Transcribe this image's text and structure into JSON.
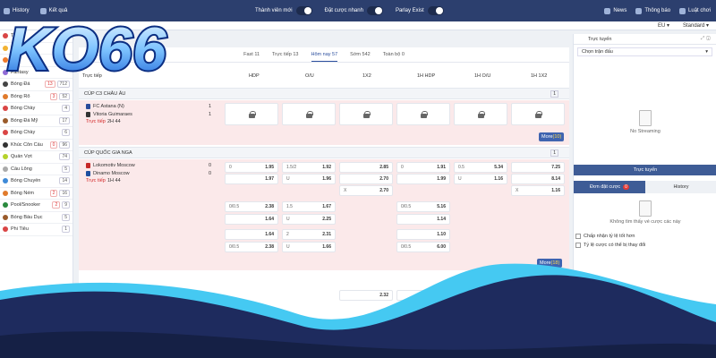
{
  "topbar": {
    "history": "History",
    "results": "Kết quả",
    "toggles": [
      "Thành viên mới",
      "Đặt cược nhanh",
      "Parlay Exist"
    ],
    "news": "News",
    "notice": "Thông báo",
    "rules": "Luật chơi"
  },
  "subbar": {
    "lang": "EU",
    "view": "Standard"
  },
  "logo": {
    "text": "KO66"
  },
  "sidebar": {
    "items": [
      {
        "label": "Trực",
        "count": "",
        "color": "#d94545"
      },
      {
        "label": "Yêu",
        "count": "",
        "color": "#f2b233"
      },
      {
        "label": "Hư",
        "count": "",
        "color": "#f07a2b"
      },
      {
        "label": "Fantasy",
        "count": "",
        "color": "#8f6bd6"
      },
      {
        "label": "Bóng Đá",
        "count": "13",
        "count2": "712",
        "color": "#444"
      },
      {
        "label": "Bóng Rổ",
        "count": "3",
        "count2": "52",
        "color": "#e07a2b"
      },
      {
        "label": "Bóng Chày",
        "count": "4",
        "count2": "",
        "color": "#d94545"
      },
      {
        "label": "Bóng Đá Mỹ",
        "count": "17",
        "count2": "",
        "color": "#9a5b2b"
      },
      {
        "label": "Bóng Chày",
        "count": "6",
        "count2": "",
        "color": "#d94545"
      },
      {
        "label": "Khúc Côn Cầu",
        "count": "0",
        "count2": "96",
        "color": "#333"
      },
      {
        "label": "Quần Vợt",
        "count": "74",
        "count2": "",
        "color": "#b5d22b"
      },
      {
        "label": "Cầu Lông",
        "count": "5",
        "count2": "",
        "color": "#aaa"
      },
      {
        "label": "Bóng Chuyền",
        "count": "14",
        "count2": "",
        "color": "#3e8ad8"
      },
      {
        "label": "Bóng Ném",
        "count": "2",
        "count2": "16",
        "color": "#e07a2b"
      },
      {
        "label": "Pool/Snooker",
        "count": "2",
        "count2": "9",
        "color": "#2b8a3e"
      },
      {
        "label": "Bóng Bầu Dục",
        "count": "5",
        "count2": "",
        "color": "#9a5b2b"
      },
      {
        "label": "Phi Tiêu",
        "count": "1",
        "count2": "",
        "color": "#d94545"
      }
    ]
  },
  "tabs": [
    "Fast 11",
    "Trực tiếp 13",
    "Hôm nay 57",
    "Sớm 542",
    "Toàn bộ 0"
  ],
  "columns": [
    "Trực tiếp",
    "HDP",
    "O/U",
    "1X2",
    "1H HDP",
    "1H O/U",
    "1H 1X2"
  ],
  "leagues": [
    {
      "name": "CÚP C3 CHÂU ÂU",
      "page": "1",
      "home": "FC Astana (N)",
      "away": "Vitoria Guimaraes",
      "hs": "1",
      "as": "1",
      "status": "Trực tiếp",
      "time": "2H 44",
      "more": "More",
      "more_n": "(10)"
    },
    {
      "name": "CÚP QUỐC GIA NGA",
      "page": "1",
      "home": "Lokomotiv Moscow",
      "away": "Dinamo Moscow",
      "hs": "0",
      "as": "0",
      "status": "Trực tiếp",
      "time": "1H 44",
      "more": "More",
      "more_n": "(18)"
    }
  ],
  "odds": {
    "r1": [
      [
        "0",
        "1.95"
      ],
      [
        "1.5/2",
        "1.92"
      ],
      [
        "",
        "2.85"
      ],
      [
        "0",
        "1.91"
      ],
      [
        "0.5",
        "5.34"
      ],
      [
        "",
        "7.25"
      ]
    ],
    "r2": [
      [
        "",
        "1.97"
      ],
      [
        "U",
        "1.96"
      ],
      [
        "",
        "2.70"
      ],
      [
        "",
        "1.99"
      ],
      [
        "U",
        "1.16"
      ],
      [
        "",
        "8.14"
      ]
    ],
    "r3": [
      [
        "X",
        "2.70"
      ],
      [
        "X",
        "1.16"
      ]
    ],
    "r4": [
      [
        "0/0.5",
        "2.38"
      ],
      [
        "1.5",
        "1.67"
      ],
      [
        "0/0.5",
        "5.16"
      ]
    ],
    "r5": [
      [
        "",
        "1.64"
      ],
      [
        "U",
        "2.25"
      ],
      [
        "",
        "1.14"
      ]
    ],
    "r6": [
      [
        "",
        "1.64"
      ],
      [
        "2",
        "2.31"
      ],
      [
        "",
        "1.10"
      ]
    ],
    "r7": [
      [
        "0/0.5",
        "2.38"
      ],
      [
        "U",
        "1.66"
      ],
      [
        "0/0.5",
        "6.00"
      ]
    ],
    "r8": [
      [
        "",
        "2.32"
      ],
      [
        "",
        "1.7"
      ]
    ],
    "r9": [
      [
        "",
        "2.17"
      ],
      [
        "U",
        "1.79"
      ]
    ],
    "r10": [
      [
        "X",
        ""
      ]
    ]
  },
  "right": {
    "live_title": "Trực tuyến",
    "select": "Chọn trận đấu",
    "nostream": "No Streaming",
    "live_btn": "Trực tuyến",
    "bet_tab": "Đơn đặt cược",
    "bet_count": "0",
    "history_tab": "History",
    "empty": "Không tìm thấy vé cược các này",
    "opt1": "Chấp nhận tỷ lệ tốt hơn",
    "opt2": "Tỷ lệ cược có thể bị thay đổi"
  }
}
